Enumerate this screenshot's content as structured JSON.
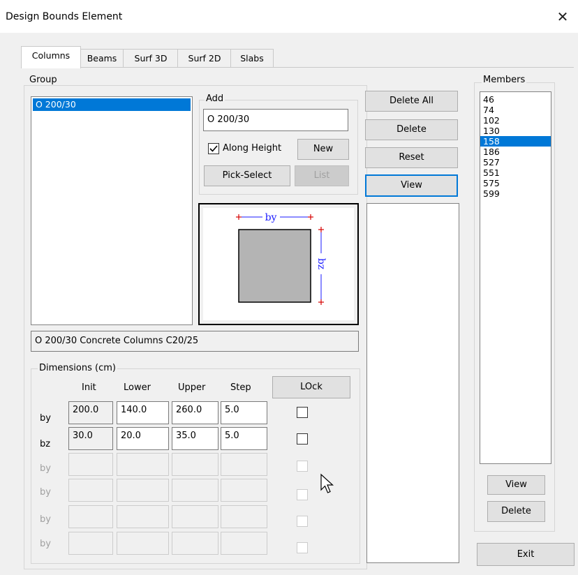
{
  "window": {
    "title": "Design Bounds Element",
    "close_glyph": "✕"
  },
  "tabs": [
    {
      "label": "Columns",
      "active": true
    },
    {
      "label": "Beams"
    },
    {
      "label": "Surf 3D"
    },
    {
      "label": "Surf 2D"
    },
    {
      "label": "Slabs"
    }
  ],
  "group": {
    "label": "Group",
    "items": [
      "O 200/30"
    ],
    "selected_index": 0,
    "description": "O 200/30 Concrete Columns C20/25"
  },
  "add": {
    "label": "Add",
    "input_value": "O 200/30",
    "along_height_label": "Along Height",
    "along_height_checked": true,
    "new_label": "New",
    "pick_select_label": "Pick-Select",
    "list_label": "List"
  },
  "section_preview": {
    "by_label": "by",
    "bz_label": "bz"
  },
  "actions": {
    "delete_all": "Delete All",
    "delete": "Delete",
    "reset": "Reset",
    "view": "View"
  },
  "dimensions": {
    "label": "Dimensions (cm)",
    "headers": [
      "Init",
      "Lower",
      "Upper",
      "Step"
    ],
    "lock_label": "LOck",
    "rows": [
      {
        "name": "by",
        "init": "200.0",
        "lower": "140.0",
        "upper": "260.0",
        "step": "5.0",
        "enabled": true
      },
      {
        "name": "bz",
        "init": "30.0",
        "lower": "20.0",
        "upper": "35.0",
        "step": "5.0",
        "enabled": true
      },
      {
        "name": "by",
        "init": "",
        "lower": "",
        "upper": "",
        "step": "",
        "enabled": false
      },
      {
        "name": "by",
        "init": "",
        "lower": "",
        "upper": "",
        "step": "",
        "enabled": false
      },
      {
        "name": "by",
        "init": "",
        "lower": "",
        "upper": "",
        "step": "",
        "enabled": false
      },
      {
        "name": "by",
        "init": "",
        "lower": "",
        "upper": "",
        "step": "",
        "enabled": false
      }
    ]
  },
  "members": {
    "label": "Members",
    "items": [
      "46",
      "74",
      "102",
      "130",
      "158",
      "186",
      "527",
      "551",
      "575",
      "599"
    ],
    "selected_index": 4,
    "view_label": "View",
    "delete_label": "Delete"
  },
  "exit_label": "Exit",
  "colors": {
    "selection": "#0078d7",
    "dimension_line": "#1a1aff",
    "dimension_marker": "#d40000",
    "section_fill": "#b4b4b4"
  }
}
